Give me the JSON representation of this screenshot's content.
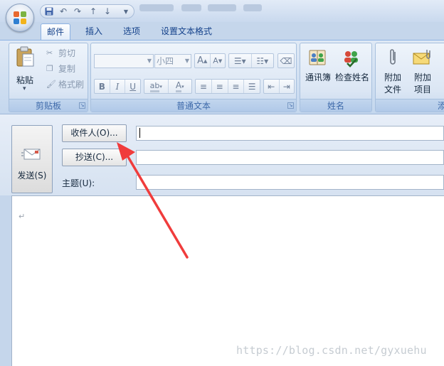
{
  "quick_access": {
    "icons": [
      "save-icon",
      "undo-icon",
      "redo-icon",
      "up-arrow-icon",
      "down-arrow-icon",
      "customize-dropdown-icon"
    ]
  },
  "tabs": [
    {
      "label": "邮件",
      "active": true
    },
    {
      "label": "插入",
      "active": false
    },
    {
      "label": "选项",
      "active": false
    },
    {
      "label": "设置文本格式",
      "active": false
    }
  ],
  "ribbon": {
    "clipboard": {
      "paste_label": "粘贴",
      "paste_arrow": "▾",
      "cut_label": "剪切",
      "copy_label": "复制",
      "format_painter_label": "格式刷",
      "group_label": "剪贴板"
    },
    "basic_text": {
      "font_name": "",
      "font_size": "小四",
      "grow_font": "A",
      "shrink_font": "A",
      "bold": "B",
      "italic": "I",
      "underline": "U",
      "highlight": "ab",
      "font_color": "A",
      "group_label": "普通文本"
    },
    "names": {
      "address_book_label": "通讯簿",
      "check_names_label": "检查姓名",
      "group_label": "姓名"
    },
    "include": {
      "attach_file_line1": "附加",
      "attach_file_line2": "文件",
      "attach_item_line1": "附加",
      "attach_item_line2": "项目",
      "group_label_partial": "添"
    }
  },
  "compose": {
    "send_label": "发送(S)",
    "to_button": "收件人(O)...",
    "cc_button": "抄送(C)...",
    "subject_label": "主题(U):",
    "to_value": "",
    "cc_value": "",
    "subject_value": ""
  },
  "body": {
    "paragraph_mark": "↵",
    "watermark": "https://blog.csdn.net/gyxuehu"
  },
  "colors": {
    "ribbon_bg": "#dfe9f5",
    "group_label_text": "#3e6aaa",
    "annotation_arrow": "#f03c3c"
  }
}
